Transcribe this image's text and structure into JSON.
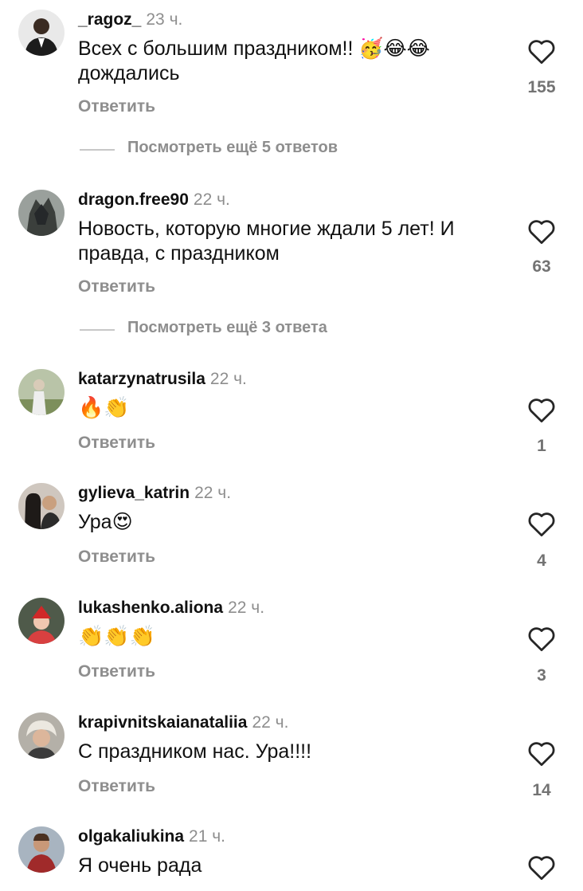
{
  "reply_label": "Ответить",
  "comments": [
    {
      "username": "_ragoz_",
      "time": "23 ч.",
      "text": "Всех с большим праздником!! 🥳😂😂 дождались",
      "likes": "155",
      "more_replies": "Посмотреть ещё 5 ответов"
    },
    {
      "username": "dragon.free90",
      "time": "22 ч.",
      "text": "Новость, которую многие ждали 5 лет! И правда, с праздником",
      "likes": "63",
      "more_replies": "Посмотреть ещё 3 ответа"
    },
    {
      "username": "katarzynatrusila",
      "time": "22 ч.",
      "text": "🔥👏",
      "likes": "1"
    },
    {
      "username": "gylieva_katrin",
      "time": "22 ч.",
      "text": "Ура😍",
      "likes": "4"
    },
    {
      "username": "lukashenko.aliona",
      "time": "22 ч.",
      "text": "👏👏👏",
      "likes": "3"
    },
    {
      "username": "krapivnitskaianataliia",
      "time": "22 ч.",
      "text": "С праздником нас. Ура!!!!",
      "likes": "14"
    },
    {
      "username": "olgakaliukina",
      "time": "21 ч.",
      "text": "Я очень рада"
    }
  ],
  "colors": {
    "text": "#111111",
    "secondary": "#8e8e8e",
    "count": "#737373",
    "divider": "#c7c7c7"
  },
  "icons": {
    "like": "heart-outline-icon"
  }
}
